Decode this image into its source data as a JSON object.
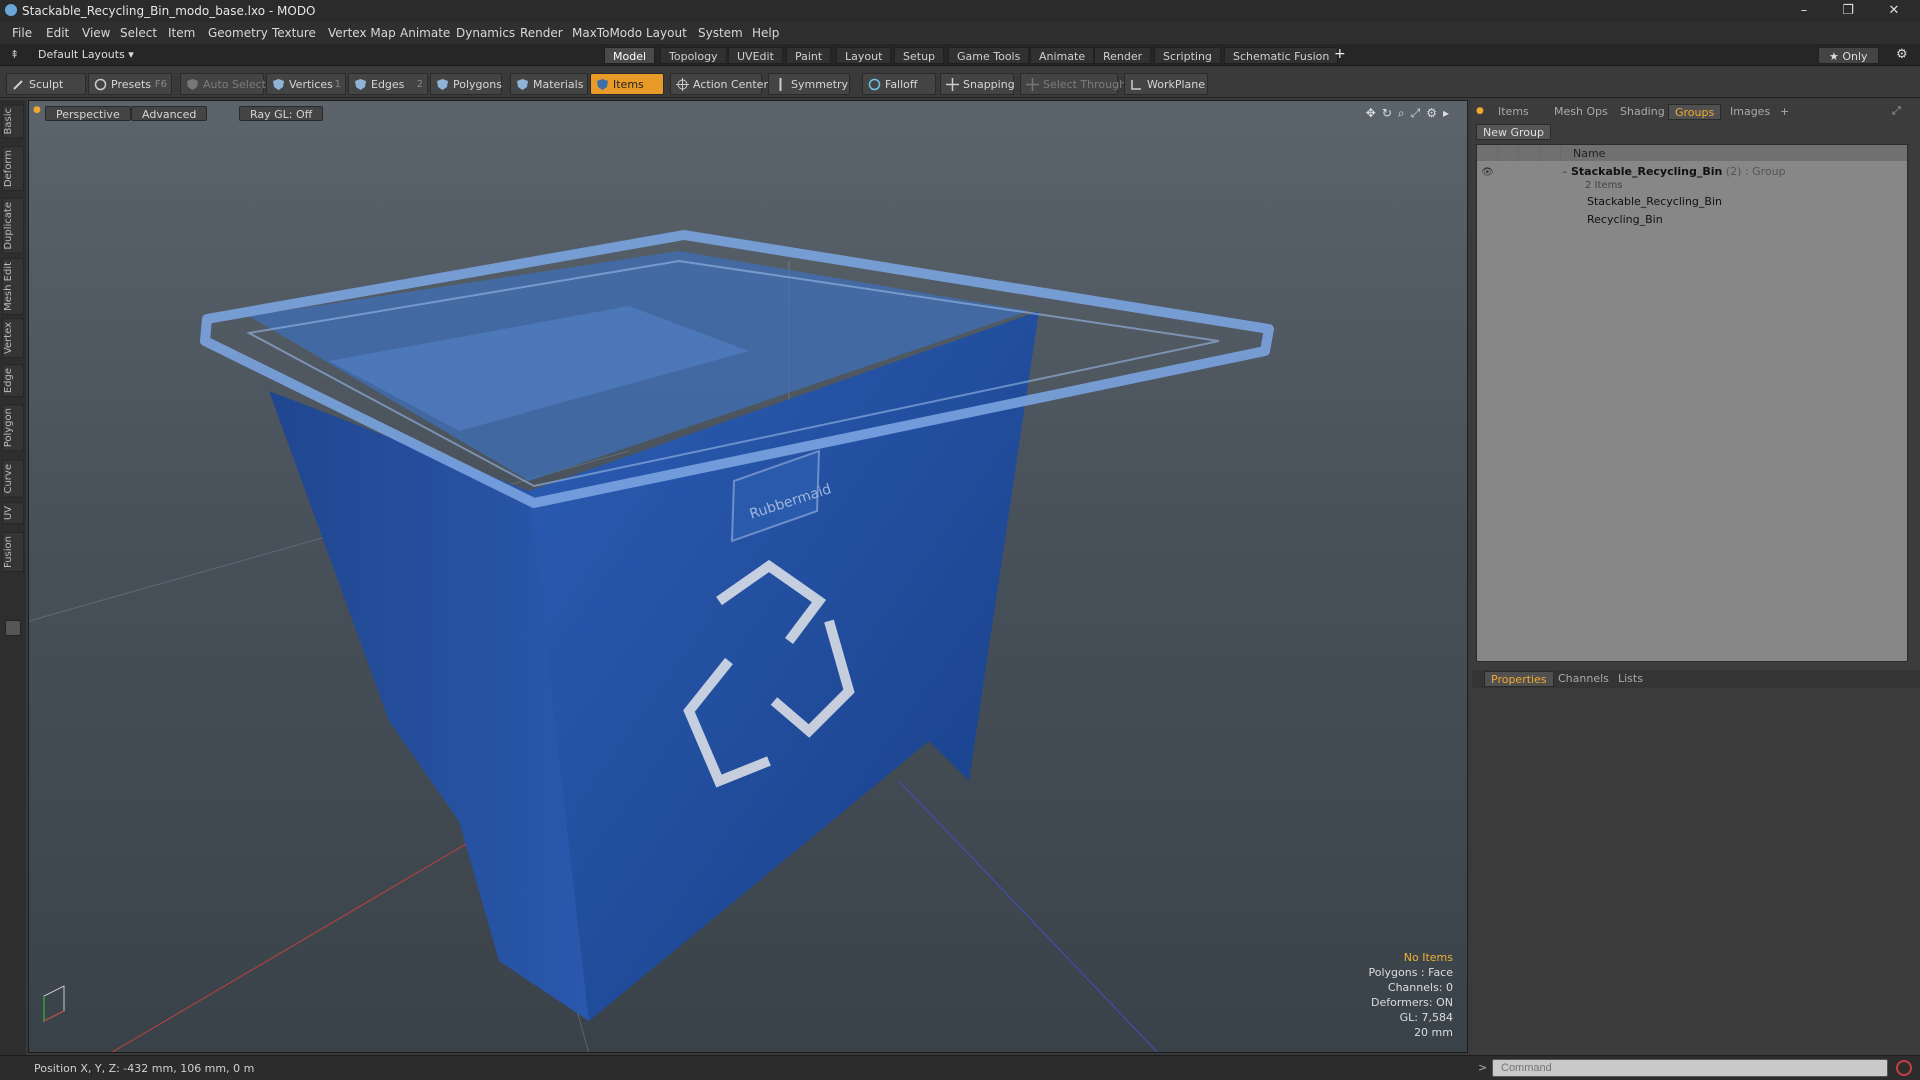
{
  "window": {
    "title": "Stackable_Recycling_Bin_modo_base.lxo - MODO",
    "controls": [
      "–",
      "❐",
      "✕"
    ]
  },
  "menu": [
    "File",
    "Edit",
    "View",
    "Select",
    "Item",
    "Geometry",
    "Texture",
    "Vertex Map",
    "Animate",
    "Dynamics",
    "Render",
    "MaxToModo",
    "Layout",
    "System",
    "Help"
  ],
  "layout_bar": {
    "layout_select": "Default Layouts ▾",
    "tabs": [
      "Model",
      "Topology",
      "UVEdit",
      "Paint",
      "Layout",
      "Setup",
      "Game Tools",
      "Animate",
      "Render",
      "Scripting",
      "Schematic Fusion"
    ],
    "active_tab": "Model",
    "add": "+",
    "only": "★ Only"
  },
  "toolbar": {
    "sculpt": "Sculpt",
    "presets": "Presets",
    "presets_key": "F6",
    "auto_select": "Auto Select",
    "vertices": "Vertices",
    "vertices_count": "1",
    "edges": "Edges",
    "edges_count": "2",
    "polygons": "Polygons",
    "materials": "Materials",
    "items": "Items",
    "action_center": "Action Center",
    "symmetry": "Symmetry",
    "falloff": "Falloff",
    "snapping": "Snapping",
    "select_through": "Select Through",
    "workplane": "WorkPlane"
  },
  "left_tabs": [
    "Basic",
    "Deform",
    "Duplicate",
    "Mesh Edit",
    "Vertex",
    "Edge",
    "Polygon",
    "Curve",
    "UV",
    "Fusion"
  ],
  "viewport": {
    "view": "Perspective",
    "shading": "Advanced",
    "raygl": "Ray GL: Off",
    "logo_text": "Rubbermaid",
    "info": {
      "selection": "No Items",
      "polygons": "Polygons : Face",
      "channels": "Channels: 0",
      "deformers": "Deformers: ON",
      "gl": "GL: 7,584",
      "scale": "20 mm"
    }
  },
  "right_panel": {
    "top_tabs": [
      "Items",
      "Mesh Ops",
      "Shading",
      "Groups",
      "Images"
    ],
    "active_top_tab": "Groups",
    "new_group": "New Group",
    "column_name": "Name",
    "group": {
      "name": "Stackable_Recycling_Bin",
      "count": "(2)",
      "type": ": Group",
      "sub": "2 Items",
      "children": [
        "Stackable_Recycling_Bin",
        "Recycling_Bin"
      ]
    },
    "bottom_tabs": [
      "Properties",
      "Channels",
      "Lists"
    ],
    "active_bottom_tab": "Properties"
  },
  "status": {
    "position": "Position X, Y, Z:  -432 mm, 106 mm, 0 m",
    "command_placeholder": "Command"
  },
  "colors": {
    "accent": "#e99b2a",
    "bin_blue": "#1f4fa3",
    "viewport_bg": "#4c555d"
  }
}
